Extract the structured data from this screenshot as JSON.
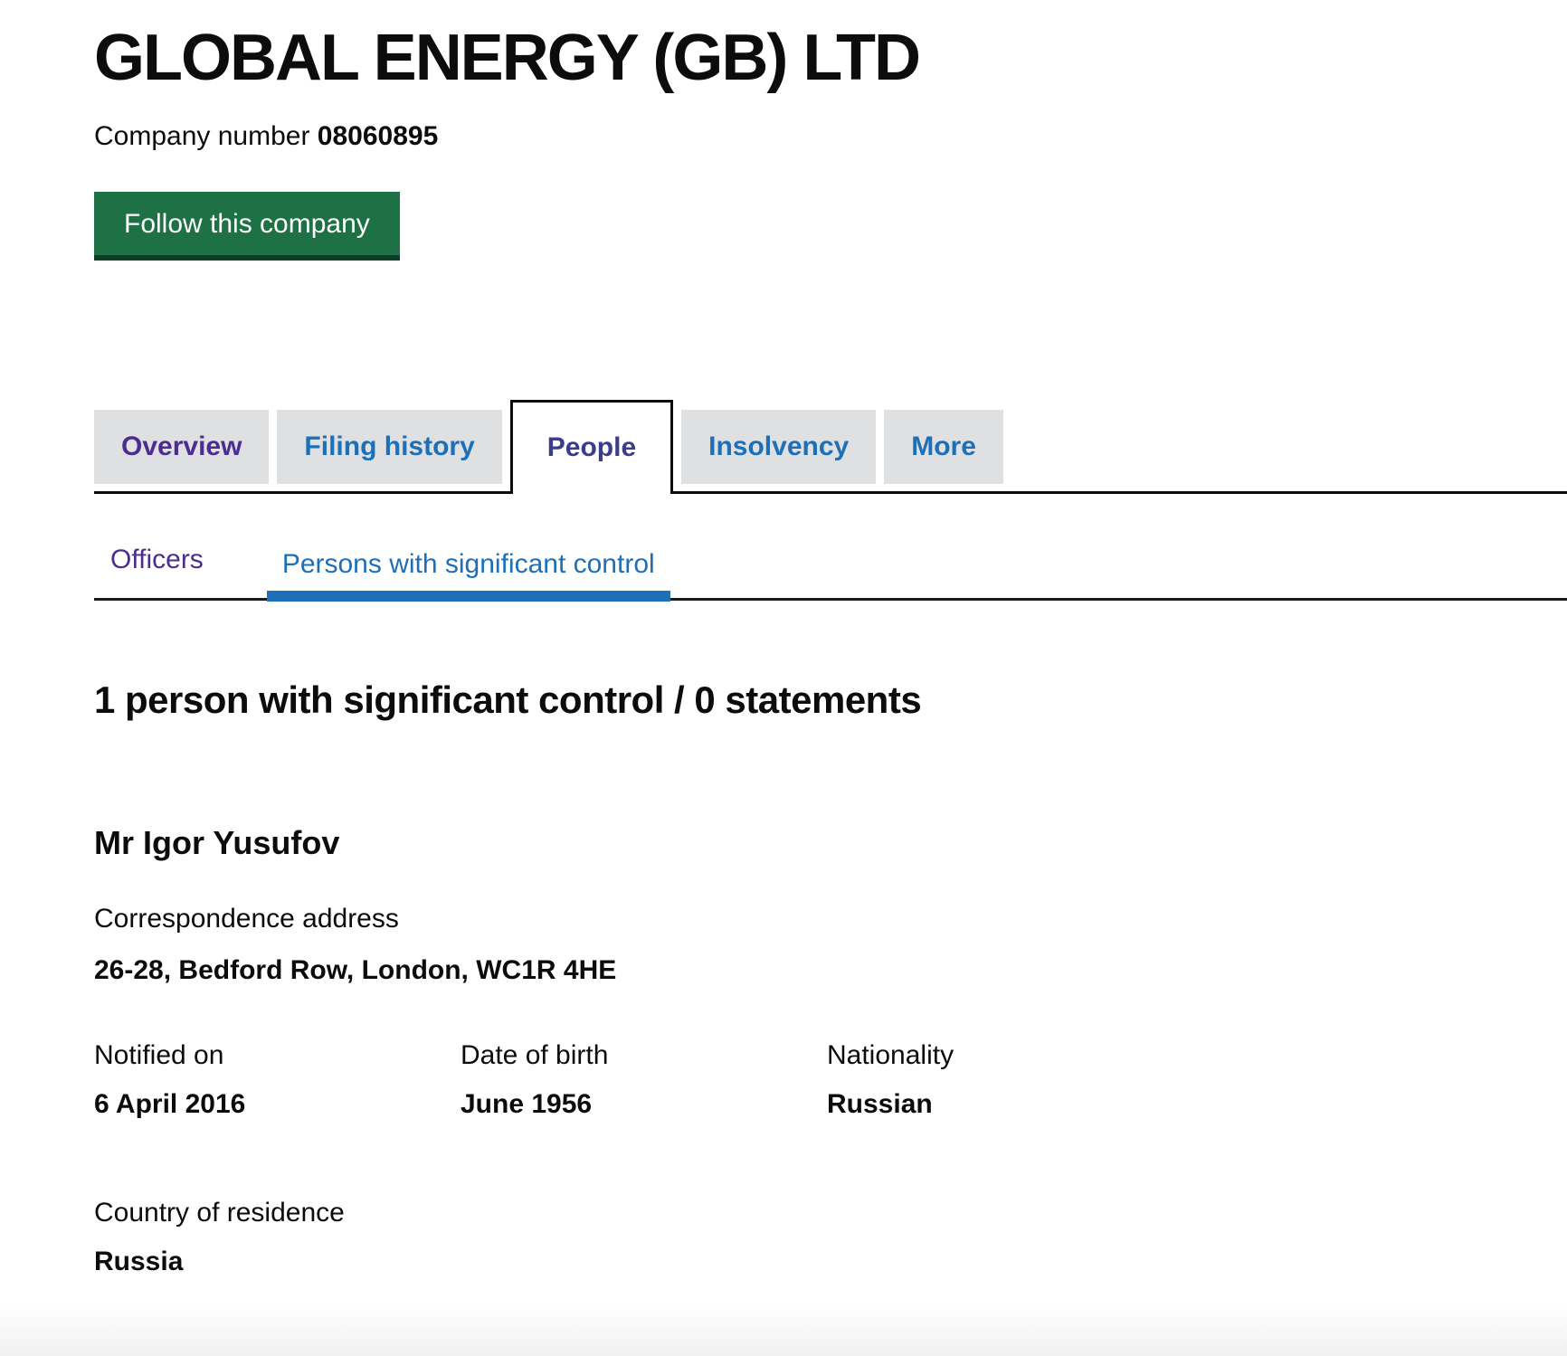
{
  "header": {
    "company_name": "GLOBAL ENERGY (GB) LTD",
    "company_number_label": "Company number",
    "company_number": "08060895",
    "follow_button_label": "Follow this company"
  },
  "tabs": [
    {
      "label": "Overview",
      "state": "visited"
    },
    {
      "label": "Filing history",
      "state": "link"
    },
    {
      "label": "People",
      "state": "active"
    },
    {
      "label": "Insolvency",
      "state": "link"
    },
    {
      "label": "More",
      "state": "link"
    }
  ],
  "subnav": [
    {
      "label": "Officers",
      "state": "visited"
    },
    {
      "label": "Persons with significant control",
      "state": "active"
    }
  ],
  "psc": {
    "heading": "1 person with significant control / 0 statements",
    "person": {
      "name": "Mr Igor Yusufov",
      "correspondence_address_label": "Correspondence address",
      "correspondence_address": "26-28, Bedford Row, London, WC1R 4HE",
      "fields": [
        {
          "label": "Notified on",
          "value": "6 April 2016"
        },
        {
          "label": "Date of birth",
          "value": "June 1956"
        },
        {
          "label": "Nationality",
          "value": "Russian"
        },
        {
          "label": "Country of residence",
          "value": "Russia"
        }
      ]
    }
  },
  "colors": {
    "text": "#0b0c0c",
    "link_blue": "#1d70b8",
    "visited_purple": "#4c2c92",
    "active_tab_text": "#3c3c8c",
    "tab_background": "#dee0e2",
    "button_green": "#1e7145",
    "active_underline_blue": "#1d70b8"
  }
}
